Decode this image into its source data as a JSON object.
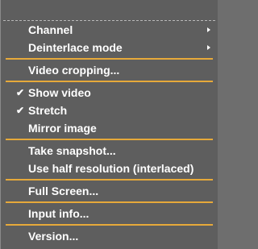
{
  "menu": {
    "groups": [
      {
        "items": [
          {
            "label": "Channel",
            "checked": false,
            "submenu": true
          },
          {
            "label": "Deinterlace mode",
            "checked": false,
            "submenu": true
          }
        ]
      },
      {
        "items": [
          {
            "label": "Video cropping...",
            "checked": false,
            "submenu": false
          }
        ]
      },
      {
        "items": [
          {
            "label": "Show video",
            "checked": true,
            "submenu": false
          },
          {
            "label": "Stretch",
            "checked": true,
            "submenu": false
          },
          {
            "label": "Mirror image",
            "checked": false,
            "submenu": false
          }
        ]
      },
      {
        "items": [
          {
            "label": "Take snapshot...",
            "checked": false,
            "submenu": false
          },
          {
            "label": "Use half resolution (interlaced)",
            "checked": false,
            "submenu": false
          }
        ]
      },
      {
        "items": [
          {
            "label": "Full Screen...",
            "checked": false,
            "submenu": false
          }
        ]
      },
      {
        "items": [
          {
            "label": "Input info...",
            "checked": false,
            "submenu": false
          }
        ]
      },
      {
        "items": [
          {
            "label": "Version...",
            "checked": false,
            "submenu": false
          }
        ]
      }
    ],
    "check_glyph": "✔",
    "colors": {
      "background": "#5e5e5e",
      "text": "#ffffff",
      "separator": "#e6a93a"
    }
  }
}
